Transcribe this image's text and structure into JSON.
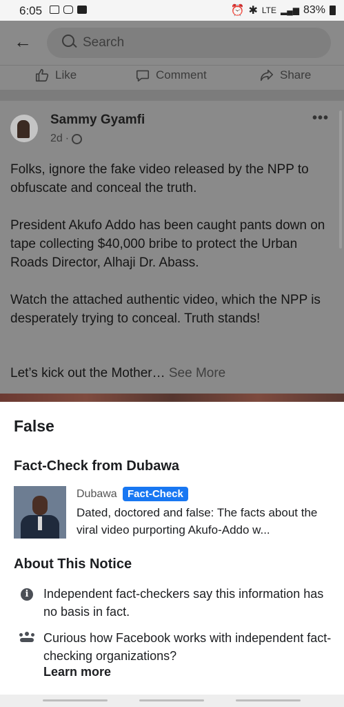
{
  "status_bar": {
    "time": "6:05",
    "network": "LTE",
    "battery": "83%"
  },
  "search": {
    "placeholder": "Search"
  },
  "action_bar": {
    "like": "Like",
    "comment": "Comment",
    "share": "Share"
  },
  "post": {
    "author": "Sammy Gyamfi",
    "age": "2d",
    "paragraphs": [
      "Folks, ignore the fake video released by the NPP to obfuscate and conceal the truth.",
      "President Akufo Addo has been caught pants down on tape collecting $40,000 bribe to protect the Urban Roads Director, Alhaji Dr. Abass.",
      "Watch the attached authentic video, which the NPP is desperately trying to conceal. Truth stands!"
    ],
    "truncated_line": "Let’s kick out the Mother…",
    "see_more": "See More"
  },
  "notice": {
    "rating": "False",
    "fact_check_title": "Fact-Check from Dubawa",
    "article": {
      "publisher": "Dubawa",
      "badge": "Fact-Check",
      "headline": "Dated, doctored and false: The facts about the viral video purporting Akufo-Addo w..."
    },
    "about_title": "About This Notice",
    "info_text": "Independent fact-checkers say this information has no basis in fact.",
    "curious_text": "Curious how Facebook works with independent fact-checking organizations?",
    "learn_more": "Learn more"
  },
  "colors": {
    "accent": "#1877f2",
    "dim_overlay": "#8a8a8a",
    "text": "#1c1e21"
  }
}
